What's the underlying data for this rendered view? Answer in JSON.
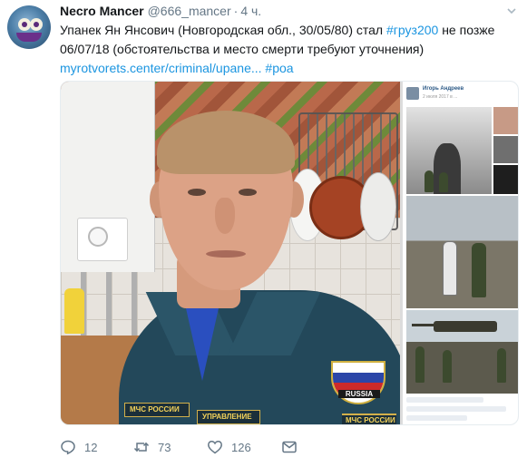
{
  "tweet": {
    "display_name": "Necro Mancer",
    "handle": "@666_mancer",
    "separator": "·",
    "time": "4 ч.",
    "text_part1": "Упанек Ян Янсович (Новгородская обл., 30/05/80) стал ",
    "hashtag_cargo": "#груз200",
    "text_part2": " не позже 06/07/18 (обстоятельства и место смерти требуют уточнения)",
    "link": "myrotvorets.center/criminal/upane...",
    "hashtag_poa": "#роа",
    "counts": {
      "replies": "12",
      "retweets": "73",
      "likes": "126"
    }
  },
  "media": {
    "patch_label": "RUSSIA",
    "stripe_left": "МЧС РОССИИ",
    "stripe_right": "УПРАВЛЕНИЕ",
    "stripe_bottom": "МЧС РОССИИ",
    "panel_name": "Игорь Андреев",
    "panel_date": "2 июля 2017 в ..."
  },
  "colors": {
    "link": "#1b95e0",
    "text": "#14171a",
    "muted": "#657786"
  },
  "icons": [
    "reply-icon",
    "retweet-icon",
    "like-icon",
    "direct-message-icon",
    "caret-down-icon"
  ]
}
